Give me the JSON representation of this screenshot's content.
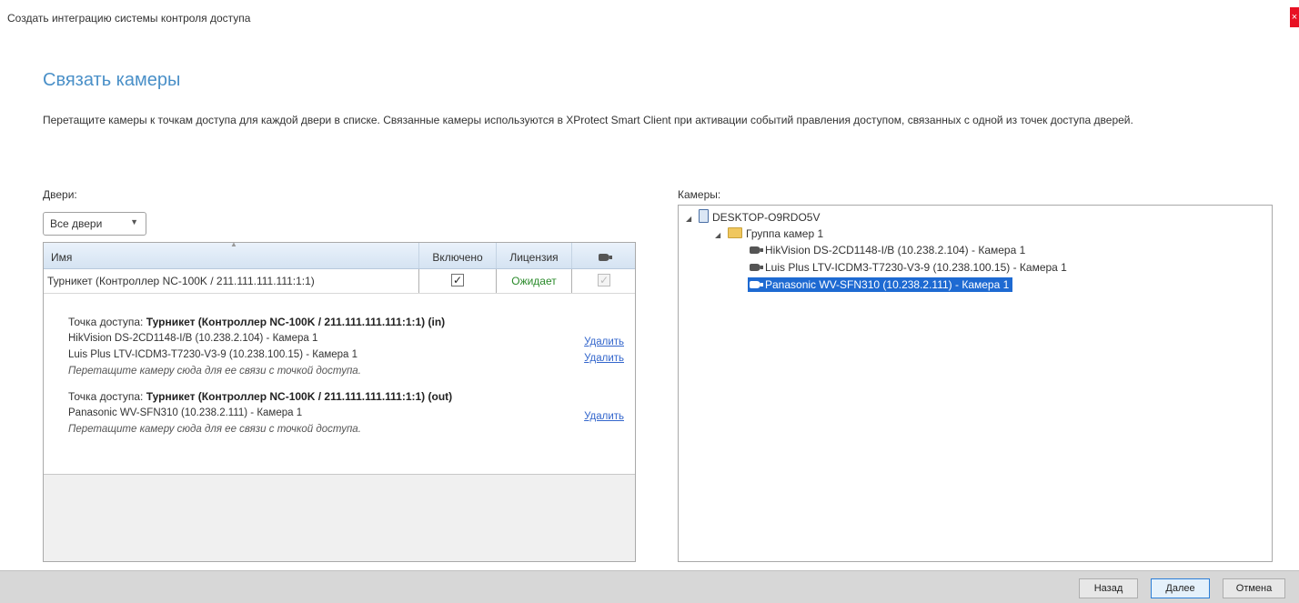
{
  "window": {
    "title": "Создать интеграцию системы контроля доступа",
    "close_label": "×"
  },
  "page": {
    "heading": "Связать камеры",
    "description": "Перетащите камеры к точкам доступа для каждой двери в списке. Связанные камеры используются в XProtect Smart Client при активации событий правления доступом, связанных с одной из точек доступа дверей."
  },
  "doors": {
    "label": "Двери:",
    "filter": {
      "selected": "Все двери"
    },
    "columns": {
      "name": "Имя",
      "enabled": "Включено",
      "license": "Лицензия"
    },
    "rows": [
      {
        "name": "Турникет (Контроллер NC-100K / 211.111.111.111:1:1)",
        "enabled": "✓",
        "license": "Ожидает",
        "extra": "✓"
      }
    ],
    "access_points": [
      {
        "prefix": "Точка доступа: ",
        "name": "Турникет (Контроллер NC-100K / 211.111.111.111:1:1) (in)",
        "cameras": [
          {
            "name": "HikVision DS-2CD1148-I/B (10.238.2.104) - Камера 1",
            "remove": "Удалить"
          },
          {
            "name": "Luis Plus LTV-ICDM3-T7230-V3-9 (10.238.100.15) - Камера 1",
            "remove": "Удалить"
          }
        ],
        "hint": "Перетащите камеру сюда для ее связи с точкой доступа."
      },
      {
        "prefix": "Точка доступа: ",
        "name": "Турникет (Контроллер NC-100K / 211.111.111.111:1:1) (out)",
        "cameras": [
          {
            "name": "Panasonic WV-SFN310 (10.238.2.111) - Камера 1",
            "remove": "Удалить"
          }
        ],
        "hint": "Перетащите камеру сюда для ее связи с точкой доступа."
      }
    ]
  },
  "cameras": {
    "label": "Камеры:",
    "tree": {
      "server": "DESKTOP-O9RDO5V",
      "group": "Группа камер 1",
      "items": [
        "HikVision DS-2CD1148-I/B (10.238.2.104) - Камера 1",
        "Luis Plus LTV-ICDM3-T7230-V3-9 (10.238.100.15) - Камера 1",
        "Panasonic WV-SFN310 (10.238.2.111) - Камера 1"
      ],
      "selected_item": "Panasonic WV-SFN310 (10.238.2.111) - Камера 1"
    }
  },
  "footer": {
    "back": "Назад",
    "next": "Далее",
    "cancel": "Отмена"
  }
}
